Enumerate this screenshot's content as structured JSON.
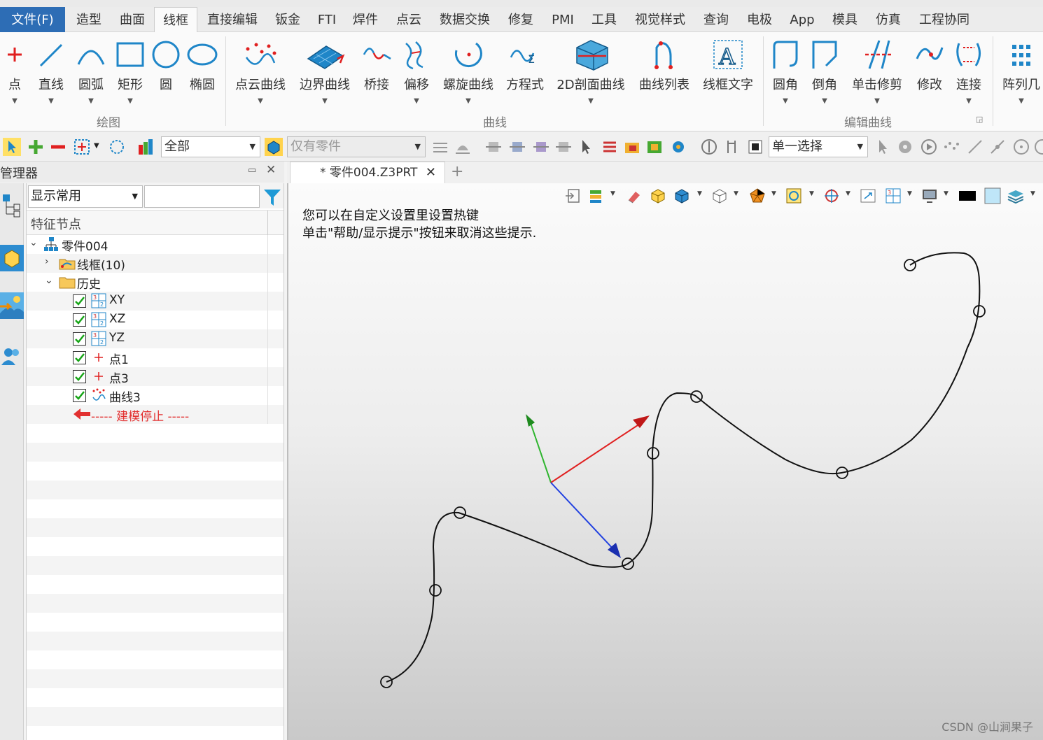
{
  "menu": {
    "file": "文件(F)",
    "tabs": [
      "造型",
      "曲面",
      "线框",
      "直接编辑",
      "钣金",
      "FTI",
      "焊件",
      "点云",
      "数据交换",
      "修复",
      "PMI",
      "工具",
      "视觉样式",
      "查询",
      "电极",
      "App",
      "模具",
      "仿真",
      "工程协同"
    ],
    "active_index": 2
  },
  "ribbon": {
    "draw": {
      "group": "绘图",
      "items": [
        "点",
        "直线",
        "圆弧",
        "矩形",
        "圆",
        "椭圆"
      ]
    },
    "curve": {
      "group": "曲线",
      "items": [
        "点云曲线",
        "边界曲线",
        "桥接",
        "偏移",
        "螺旋曲线",
        "方程式",
        "2D剖面曲线",
        "曲线列表",
        "线框文字"
      ]
    },
    "edit": {
      "group": "编辑曲线",
      "items": [
        "圆角",
        "倒角",
        "单击修剪",
        "修改",
        "连接"
      ]
    },
    "extra": {
      "items": [
        "阵列几"
      ]
    }
  },
  "toolbar": {
    "filter_all": "全部",
    "parts_only": "仅有零件",
    "select_mode": "单一选择"
  },
  "manager": {
    "title": "管理器",
    "filter_combo": "显示常用",
    "filter_text": "",
    "column_header": "特征节点",
    "tree": [
      {
        "label": "零件004",
        "icon": "part-tree-icon",
        "checkbox": false,
        "expander": "∨"
      },
      {
        "label": "线框(10)",
        "icon": "wireframe-folder-icon",
        "checkbox": false,
        "expander": "›"
      },
      {
        "label": "历史",
        "icon": "history-folder-icon",
        "checkbox": false,
        "expander": "∨"
      },
      {
        "label": "XY",
        "icon": "datum-plane-icon",
        "checkbox": true
      },
      {
        "label": "XZ",
        "icon": "datum-plane-icon",
        "checkbox": true
      },
      {
        "label": "YZ",
        "icon": "datum-plane-icon",
        "checkbox": true
      },
      {
        "label": "点1",
        "icon": "point-feature-icon",
        "checkbox": true
      },
      {
        "label": "点3",
        "icon": "point-feature-icon",
        "checkbox": true
      },
      {
        "label": "曲线3",
        "icon": "point-cloud-curve-icon",
        "checkbox": true
      },
      {
        "label": "----- 建模停止 -----",
        "icon": "stop-arrow-icon",
        "checkbox": false,
        "stop": true
      }
    ]
  },
  "document": {
    "tab_title": "* 零件004.Z3PRT"
  },
  "viewport": {
    "hint_line1": "您可以在自定义设置里设置热键",
    "hint_line2": "单击\"帮助/显示提示\"按钮来取消这些提示.",
    "watermark": "CSDN @山涧果子"
  },
  "colors": {
    "accent": "#2d6db5",
    "axis_x": "#e02020",
    "axis_y": "#2fb52f",
    "axis_z": "#2040e0",
    "stop_text": "#e23030"
  }
}
